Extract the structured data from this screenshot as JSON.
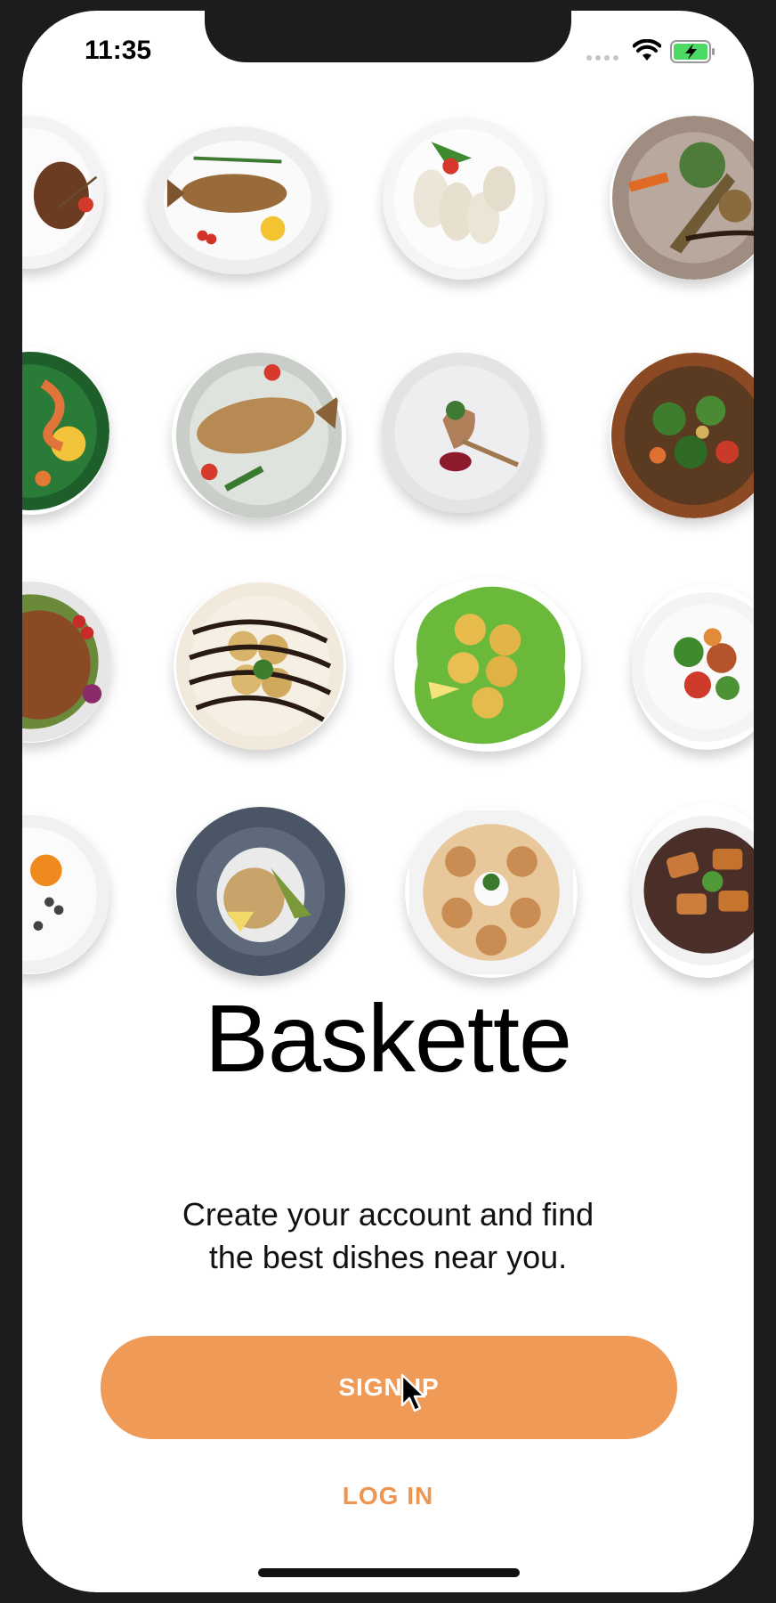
{
  "status_bar": {
    "time": "11:35"
  },
  "app": {
    "name": "Baskette",
    "tagline_line1": "Create your account and find",
    "tagline_line2": "the best dishes near you."
  },
  "actions": {
    "signup_label": "SIGNUP",
    "login_label": "LOG IN"
  },
  "colors": {
    "accent": "#f09a57",
    "login_text": "#ee9552"
  },
  "icons": [
    "wifi-icon",
    "battery-charging-icon",
    "cursor-arrow-icon"
  ],
  "food_grid": [
    "grilled-steak-plate",
    "grilled-fish-plate",
    "chicken-roll-plate",
    "fish-salad-plate",
    "shrimp-leaf-plate",
    "grilled-fish-tomato-plate",
    "duck-leg-plate",
    "vegetable-salad-bowl",
    "roast-chicken-plate",
    "pastry-chocolate-plate",
    "croquettes-lettuce-plate",
    "warm-salad-plate",
    "citrus-dessert-plate",
    "rice-avocado-plate",
    "pasta-rolls-plate",
    "grilled-chicken-greens-plate"
  ]
}
